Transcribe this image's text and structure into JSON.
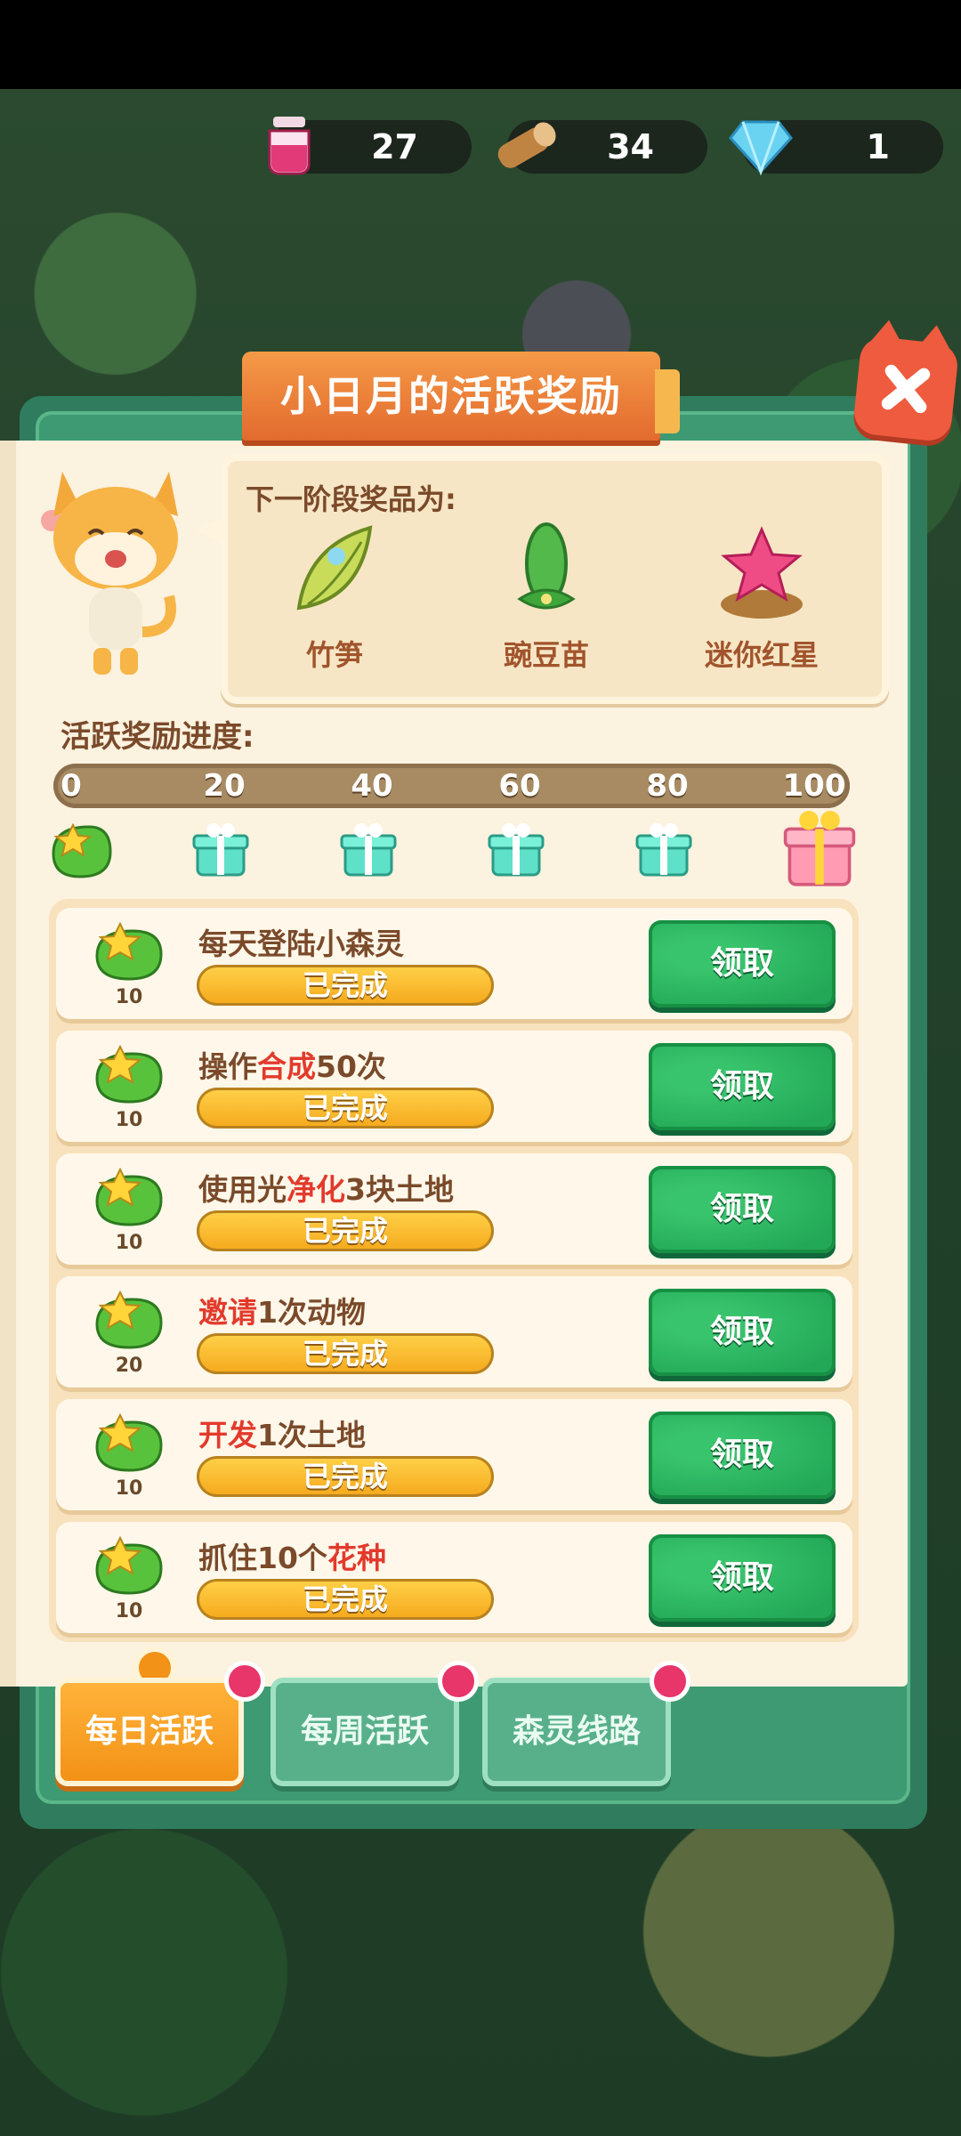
{
  "resources": [
    {
      "icon": "potion-icon",
      "value": "27",
      "color": "#e23a78"
    },
    {
      "icon": "wood-log-icon",
      "value": "34",
      "color": "#c08442"
    },
    {
      "icon": "diamond-icon",
      "value": "1",
      "color": "#6ad3f2"
    }
  ],
  "panel": {
    "title": "小日月的活跃奖励"
  },
  "next_reward": {
    "title": "下一阶段奖品为:",
    "items": [
      {
        "label": "竹笋",
        "icon": "bamboo-shoot-icon"
      },
      {
        "label": "豌豆苗",
        "icon": "pea-sprout-icon"
      },
      {
        "label": "迷你红星",
        "icon": "mini-red-star-icon"
      }
    ]
  },
  "progress": {
    "title": "活跃奖励进度:",
    "value": 0,
    "max": 100,
    "ticks": [
      "0",
      "20",
      "40",
      "60",
      "80",
      "100"
    ],
    "milestones": [
      "leaf-star-icon",
      "gift-box-icon",
      "gift-box-icon",
      "gift-box-icon",
      "gift-box-icon",
      "big-gift-box-icon"
    ]
  },
  "tasks": [
    {
      "name_parts": [
        {
          "t": "每天登陆小森灵",
          "hl": false
        }
      ],
      "points": "10",
      "status": "已完成",
      "button": "领取"
    },
    {
      "name_parts": [
        {
          "t": "操作",
          "hl": false
        },
        {
          "t": "合成",
          "hl": true
        },
        {
          "t": "50次",
          "hl": false
        }
      ],
      "points": "10",
      "status": "已完成",
      "button": "领取"
    },
    {
      "name_parts": [
        {
          "t": "使用光",
          "hl": false
        },
        {
          "t": "净化",
          "hl": true
        },
        {
          "t": "3块土地",
          "hl": false
        }
      ],
      "points": "10",
      "status": "已完成",
      "button": "领取"
    },
    {
      "name_parts": [
        {
          "t": "邀请",
          "hl": true
        },
        {
          "t": "1次动物",
          "hl": false
        }
      ],
      "points": "20",
      "status": "已完成",
      "button": "领取"
    },
    {
      "name_parts": [
        {
          "t": "开发",
          "hl": true
        },
        {
          "t": "1次土地",
          "hl": false
        }
      ],
      "points": "10",
      "status": "已完成",
      "button": "领取"
    },
    {
      "name_parts": [
        {
          "t": "抓住10个",
          "hl": false
        },
        {
          "t": "花种",
          "hl": true
        }
      ],
      "points": "10",
      "status": "已完成",
      "button": "领取"
    }
  ],
  "tabs": [
    {
      "label": "每日活跃",
      "active": true
    },
    {
      "label": "每周活跃",
      "active": false
    },
    {
      "label": "森灵线路",
      "active": false
    }
  ]
}
